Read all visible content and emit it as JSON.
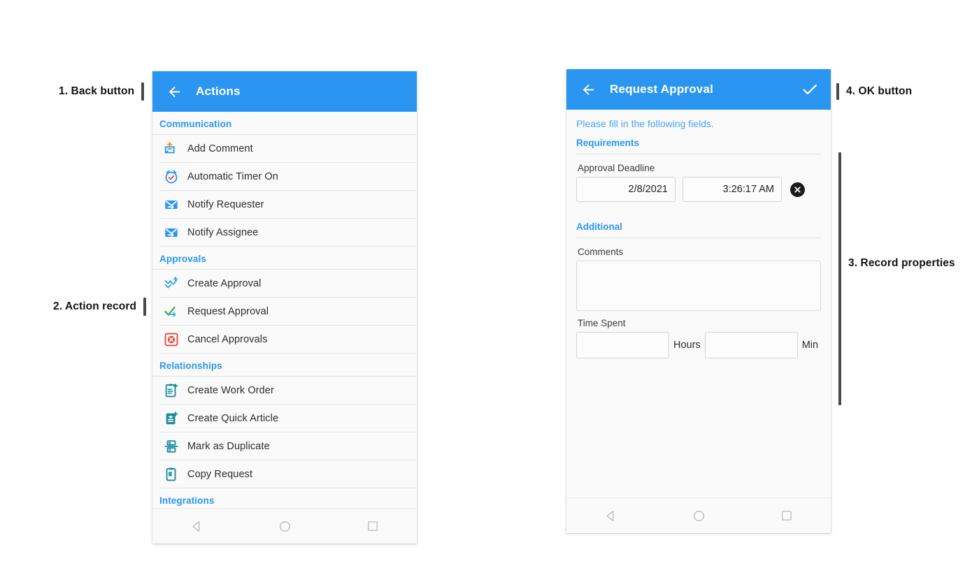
{
  "annotations": [
    {
      "id": "back-button",
      "text": "1. Back button"
    },
    {
      "id": "action-record",
      "text": "2. Action record"
    },
    {
      "id": "record-properties",
      "text": "3. Record properties"
    },
    {
      "id": "ok-button",
      "text": "4. OK button"
    }
  ],
  "colors": {
    "accent_blue": "#2a96f2",
    "section_blue": "#2a96f2",
    "hint_blue": "#4da3f0",
    "teal_icon": "#1b8ba0",
    "orange_icon": "#f4901e",
    "green_icon": "#33aa55",
    "red_icon": "#e8453c",
    "page_bg": "#ffffff",
    "screen_bg": "#fafafa"
  },
  "left_phone": {
    "appbar": {
      "title": "Actions",
      "back_icon": "arrow-left-icon"
    },
    "groups": [
      {
        "title": "Communication",
        "items": [
          {
            "label": "Add Comment",
            "icon": "add-comment-icon"
          },
          {
            "label": "Automatic Timer On",
            "icon": "alarm-check-icon"
          },
          {
            "label": "Notify Requester",
            "icon": "envelope-arrow-icon"
          },
          {
            "label": "Notify Assignee",
            "icon": "envelope-arrow-icon"
          }
        ]
      },
      {
        "title": "Approvals",
        "items": [
          {
            "label": "Create Approval",
            "icon": "approval-add-icon"
          },
          {
            "label": "Request Approval",
            "icon": "check-arrow-icon"
          },
          {
            "label": "Cancel Approvals",
            "icon": "cancel-square-icon"
          }
        ]
      },
      {
        "title": "Relationships",
        "items": [
          {
            "label": "Create Work Order",
            "icon": "clipboard-add-icon"
          },
          {
            "label": "Create Quick Article",
            "icon": "article-add-icon"
          },
          {
            "label": "Mark as Duplicate",
            "icon": "duplicate-icon"
          },
          {
            "label": "Copy Request",
            "icon": "copy-clipboard-icon"
          }
        ]
      },
      {
        "title": "Integrations",
        "items": []
      }
    ],
    "navbar": {
      "back": "nav-back-triangle-icon",
      "home": "nav-home-circle-icon",
      "recents": "nav-recents-square-icon"
    }
  },
  "right_phone": {
    "appbar": {
      "title": "Request Approval",
      "back_icon": "arrow-left-icon",
      "ok_icon": "check-icon"
    },
    "hint": "Please fill in the following fields.",
    "sections": [
      {
        "title": "Requirements",
        "fields": [
          {
            "label": "Approval Deadline",
            "type": "datetime",
            "date_value": "2/8/2021",
            "time_value": "3:26:17 AM",
            "clear_icon": "clear-circle-icon"
          }
        ]
      },
      {
        "title": "Additional",
        "fields": [
          {
            "label": "Comments",
            "type": "textarea",
            "value": "",
            "placeholder": ""
          },
          {
            "label": "Time Spent",
            "type": "duration",
            "hours_value": "",
            "hours_unit": "Hours",
            "minutes_value": "",
            "minutes_unit": "Min"
          }
        ]
      }
    ],
    "navbar": {
      "back": "nav-back-triangle-icon",
      "home": "nav-home-circle-icon",
      "recents": "nav-recents-square-icon"
    }
  }
}
